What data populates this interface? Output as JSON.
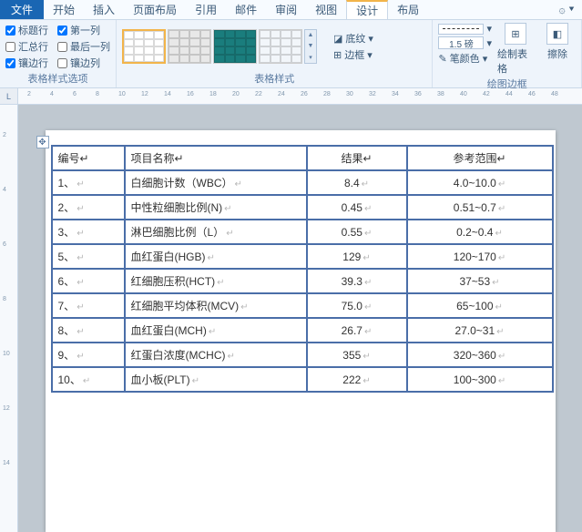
{
  "menubar": {
    "file": "文件",
    "tabs": [
      "开始",
      "插入",
      "页面布局",
      "引用",
      "邮件",
      "审阅",
      "视图",
      "设计",
      "布局"
    ],
    "active_index": 7
  },
  "ribbon": {
    "table_style_options": {
      "label": "表格样式选项",
      "items": [
        {
          "label": "标题行",
          "checked": true
        },
        {
          "label": "第一列",
          "checked": true
        },
        {
          "label": "汇总行",
          "checked": false
        },
        {
          "label": "最后一列",
          "checked": false
        },
        {
          "label": "镶边行",
          "checked": true
        },
        {
          "label": "镶边列",
          "checked": false
        }
      ]
    },
    "table_styles": {
      "label": "表格样式",
      "shading": "底纹",
      "borders": "边框"
    },
    "draw_borders": {
      "label": "绘图边框",
      "line_weight": "1.5 磅",
      "pen_color": "笔颜色",
      "draw_table": "绘制表格",
      "eraser": "擦除"
    }
  },
  "hruler_ticks": [
    "2",
    "4",
    "6",
    "8",
    "10",
    "12",
    "14",
    "16",
    "18",
    "20",
    "22",
    "24",
    "26",
    "28",
    "30",
    "32",
    "34",
    "36",
    "38",
    "40",
    "42",
    "44",
    "46",
    "48"
  ],
  "vruler_ticks": [
    "2",
    "4",
    "6",
    "8",
    "10",
    "12",
    "14"
  ],
  "document": {
    "headers": [
      "编号",
      "项目名称",
      "结果",
      "参考范围"
    ],
    "rows": [
      {
        "no": "1、",
        "name": "白细胞计数（WBC）",
        "result": "8.4",
        "range": "4.0~10.0"
      },
      {
        "no": "2、",
        "name": "中性粒细胞比例(N)",
        "result": "0.45",
        "range": "0.51~0.7"
      },
      {
        "no": "3、",
        "name": "淋巴细胞比例（L）",
        "result": "0.55",
        "range": "0.2~0.4"
      },
      {
        "no": "5、",
        "name": "血红蛋白(HGB)",
        "result": "129",
        "range": "120~170"
      },
      {
        "no": "6、",
        "name": "红细胞压积(HCT)",
        "result": "39.3",
        "range": "37~53"
      },
      {
        "no": "7、",
        "name": "红细胞平均体积(MCV)",
        "result": "75.0",
        "range": "65~100"
      },
      {
        "no": "8、",
        "name": "血红蛋白(MCH)",
        "result": "26.7",
        "range": "27.0~31"
      },
      {
        "no": "9、",
        "name": "红蛋白浓度(MCHC)",
        "result": "355",
        "range": "320~360"
      },
      {
        "no": "10、",
        "name": "血小板(PLT)",
        "result": "222",
        "range": "100~300"
      }
    ]
  }
}
